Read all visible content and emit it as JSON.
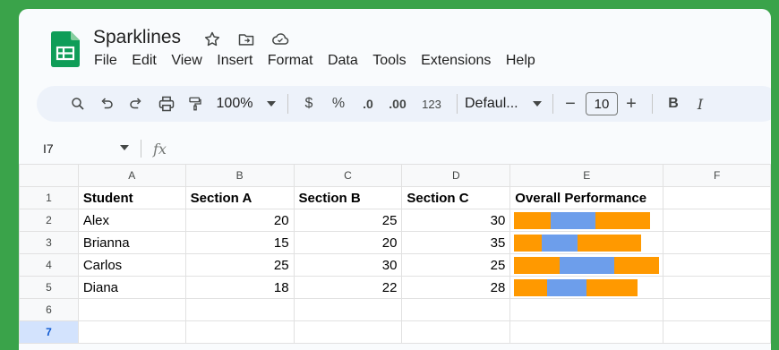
{
  "app": {
    "title": "Sparklines",
    "menu": [
      "File",
      "Edit",
      "View",
      "Insert",
      "Format",
      "Data",
      "Tools",
      "Extensions",
      "Help"
    ]
  },
  "toolbar": {
    "zoom": "100%",
    "currency": "$",
    "percent": "%",
    "decrease_decimal": ".0",
    "increase_decimal": ".00",
    "number_format": "123",
    "font": "Defaul...",
    "font_size": "10",
    "minus": "−",
    "plus": "+",
    "bold": "B",
    "italic": "I"
  },
  "formula_bar": {
    "name_box": "I7",
    "fx": "fx"
  },
  "colors": {
    "orange": "#ff9900",
    "blue": "#6d9eeb",
    "accent": "#0b57d0"
  },
  "sheet": {
    "column_headers": [
      "A",
      "B",
      "C",
      "D",
      "E",
      "F"
    ],
    "row_numbers": [
      "1",
      "2",
      "3",
      "4",
      "5",
      "6",
      "7"
    ],
    "header_row": [
      "Student",
      "Section A",
      "Section B",
      "Section C",
      "Overall Performance"
    ],
    "rows": [
      {
        "name": "Alex",
        "a": "20",
        "b": "25",
        "c": "30"
      },
      {
        "name": "Brianna",
        "a": "15",
        "b": "20",
        "c": "35"
      },
      {
        "name": "Carlos",
        "a": "25",
        "b": "30",
        "c": "25"
      },
      {
        "name": "Diana",
        "a": "18",
        "b": "22",
        "c": "28"
      }
    ],
    "sparklines": [
      [
        20,
        25,
        30
      ],
      [
        15,
        20,
        35
      ],
      [
        25,
        30,
        25
      ],
      [
        18,
        22,
        28
      ]
    ],
    "sparkline_max": 80
  }
}
